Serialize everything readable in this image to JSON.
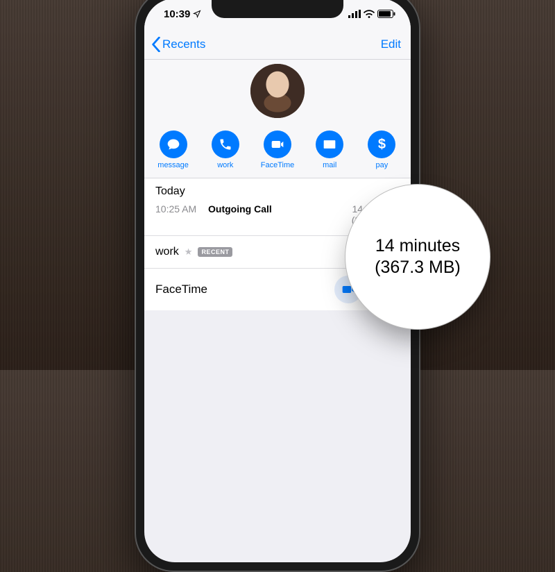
{
  "status": {
    "time": "10:39"
  },
  "nav": {
    "back": "Recents",
    "edit": "Edit"
  },
  "actions": [
    {
      "name": "message",
      "label": "message"
    },
    {
      "name": "work",
      "label": "work"
    },
    {
      "name": "facetime",
      "label": "FaceTime"
    },
    {
      "name": "mail",
      "label": "mail"
    },
    {
      "name": "pay",
      "label": "pay"
    }
  ],
  "log": {
    "header": "Today",
    "entries": [
      {
        "time": "10:25 AM",
        "kind": "Outgoing Call",
        "duration": "14 minutes",
        "data": "(367.3 MB)"
      }
    ]
  },
  "phoneSection": {
    "label": "work",
    "badge": "RECENT"
  },
  "facetime": {
    "label": "FaceTime"
  },
  "magnifier": {
    "line1": "14 minutes",
    "line2": "(367.3 MB)"
  }
}
